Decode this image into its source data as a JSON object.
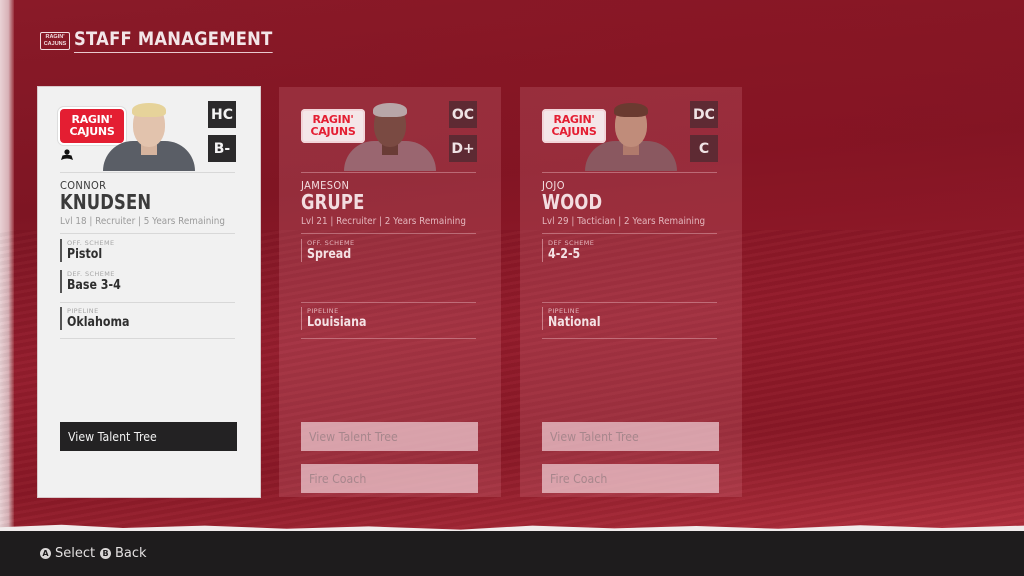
{
  "header": {
    "logo_text": [
      "RAGIN'",
      "CAJUNS"
    ],
    "title": "STAFF MANAGEMENT"
  },
  "colors": {
    "brand_red": "#e41e32",
    "background_red": "#8a1a28",
    "dark": "#232223"
  },
  "coaches": [
    {
      "state": "selected",
      "role": "HC",
      "grade": "B-",
      "first_name": "CONNOR",
      "last_name": "KNUDSEN",
      "meta": "Lvl 18 | Recruiter | 5 Years Remaining",
      "user_controlled": true,
      "fields": [
        {
          "label": "OFF. SCHEME",
          "value": "Pistol"
        },
        {
          "label": "DEF. SCHEME",
          "value": "Base 3-4"
        },
        {
          "label": "PIPELINE",
          "value": "Oklahoma"
        }
      ],
      "actions": [
        "View Talent Tree"
      ]
    },
    {
      "state": "dim",
      "role": "OC",
      "grade": "D+",
      "first_name": "JAMESON",
      "last_name": "GRUPE",
      "meta": "Lvl 21 | Recruiter | 2 Years Remaining",
      "user_controlled": false,
      "fields": [
        {
          "label": "OFF. SCHEME",
          "value": "Spread"
        },
        {
          "label": "PIPELINE",
          "value": "Louisiana"
        }
      ],
      "actions": [
        "View Talent Tree",
        "Fire Coach"
      ]
    },
    {
      "state": "dim",
      "role": "DC",
      "grade": "C",
      "first_name": "JOJO",
      "last_name": "WOOD",
      "meta": "Lvl 29 | Tactician | 2 Years Remaining",
      "user_controlled": false,
      "fields": [
        {
          "label": "DEF SCHEME",
          "value": "4-2-5"
        },
        {
          "label": "PIPELINE",
          "value": "National"
        }
      ],
      "actions": [
        "View Talent Tree",
        "Fire Coach"
      ]
    }
  ],
  "footer": {
    "hints": [
      {
        "glyph": "A",
        "label": "Select"
      },
      {
        "glyph": "B",
        "label": "Back"
      }
    ]
  }
}
